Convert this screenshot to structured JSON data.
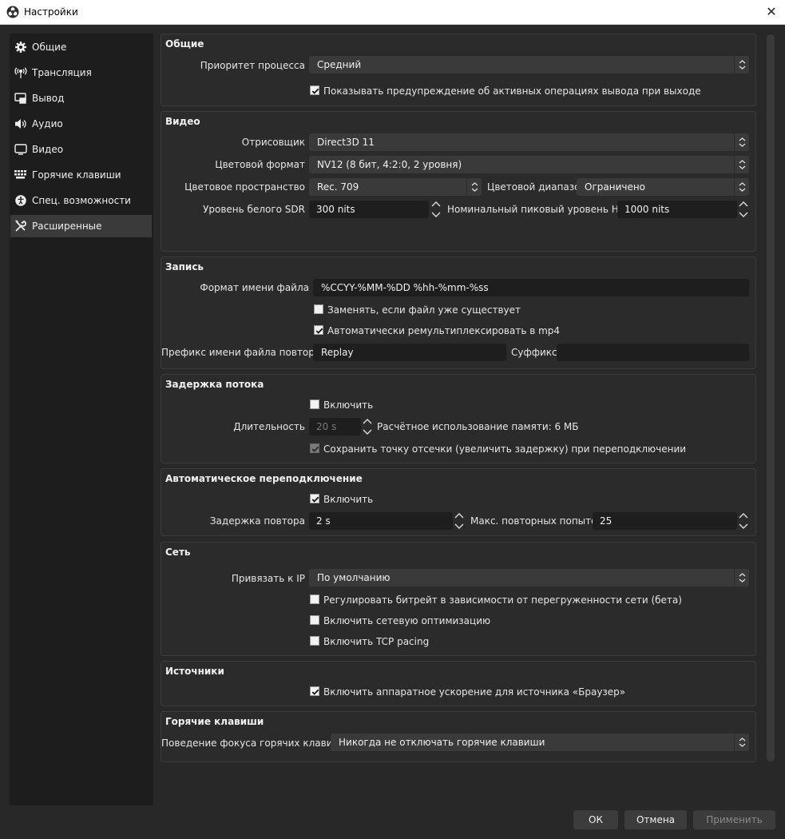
{
  "window": {
    "title": "Настройки"
  },
  "sidebar": {
    "items": [
      {
        "label": "Общие",
        "icon": "gear-icon"
      },
      {
        "label": "Трансляция",
        "icon": "antenna-icon"
      },
      {
        "label": "Вывод",
        "icon": "output-icon"
      },
      {
        "label": "Аудио",
        "icon": "speaker-icon"
      },
      {
        "label": "Видео",
        "icon": "monitor-icon"
      },
      {
        "label": "Горячие клавиши",
        "icon": "keyboard-icon"
      },
      {
        "label": "Спец. возможности",
        "icon": "accessibility-icon"
      },
      {
        "label": "Расширенные",
        "icon": "tools-icon"
      }
    ],
    "active": "Расширенные"
  },
  "general": {
    "title": "Общие",
    "priority_label": "Приоритет процесса",
    "priority_value": "Средний",
    "warn_label": "Показывать предупреждение об активных операциях вывода при выходе",
    "warn_checked": true
  },
  "video": {
    "title": "Видео",
    "renderer_label": "Отрисовщик",
    "renderer_value": "Direct3D 11",
    "format_label": "Цветовой формат",
    "format_value": "NV12 (8 бит, 4:2:0, 2 уровня)",
    "space_label": "Цветовое пространство",
    "space_value": "Rec. 709",
    "range_label": "Цветовой диапазон",
    "range_value": "Ограничено",
    "sdr_label": "Уровень белого SDR",
    "sdr_value": "300 nits",
    "hdr_label": "Номинальный пиковый уровень HDR",
    "hdr_value": "1000 nits"
  },
  "recording": {
    "title": "Запись",
    "filename_label": "Формат имени файла",
    "filename_value": "%CCYY-%MM-%DD %hh-%mm-%ss",
    "overwrite_label": "Заменять, если файл уже существует",
    "overwrite_checked": false,
    "remux_label": "Автоматически ремультиплексировать в mp4",
    "remux_checked": true,
    "prefix_label": "Префикс имени файла повтора",
    "prefix_value": "Replay",
    "suffix_label": "Суффикс",
    "suffix_value": ""
  },
  "delay": {
    "title": "Задержка потока",
    "enable_label": "Включить",
    "enable_checked": false,
    "duration_label": "Длительность",
    "duration_value": "20 s",
    "memory_text": "Расчётное использование памяти: 6 МБ",
    "preserve_label": "Сохранить точку отсечки (увеличить задержку) при переподключении",
    "preserve_checked": true
  },
  "reconnect": {
    "title": "Автоматическое переподключение",
    "enable_label": "Включить",
    "enable_checked": true,
    "retry_delay_label": "Задержка повтора",
    "retry_delay_value": "2 s",
    "max_retries_label": "Макс. повторных попыток",
    "max_retries_value": "25"
  },
  "network": {
    "title": "Сеть",
    "bind_label": "Привязать к IP",
    "bind_value": "По умолчанию",
    "dynamic_label": "Регулировать битрейт в зависимости от перегруженности сети (бета)",
    "dynamic_checked": false,
    "optimize_label": "Включить сетевую оптимизацию",
    "optimize_checked": false,
    "tcp_label": "Включить TCP pacing",
    "tcp_checked": false
  },
  "sources": {
    "title": "Источники",
    "browser_label": "Включить аппаратное ускорение для источника «Браузер»",
    "browser_checked": true
  },
  "hotkeys": {
    "title": "Горячие клавиши",
    "focus_label": "Поведение фокуса горячих клавиш",
    "focus_value": "Никогда не отключать горячие клавиши"
  },
  "buttons": {
    "ok": "ОК",
    "cancel": "Отмена",
    "apply": "Применить"
  }
}
